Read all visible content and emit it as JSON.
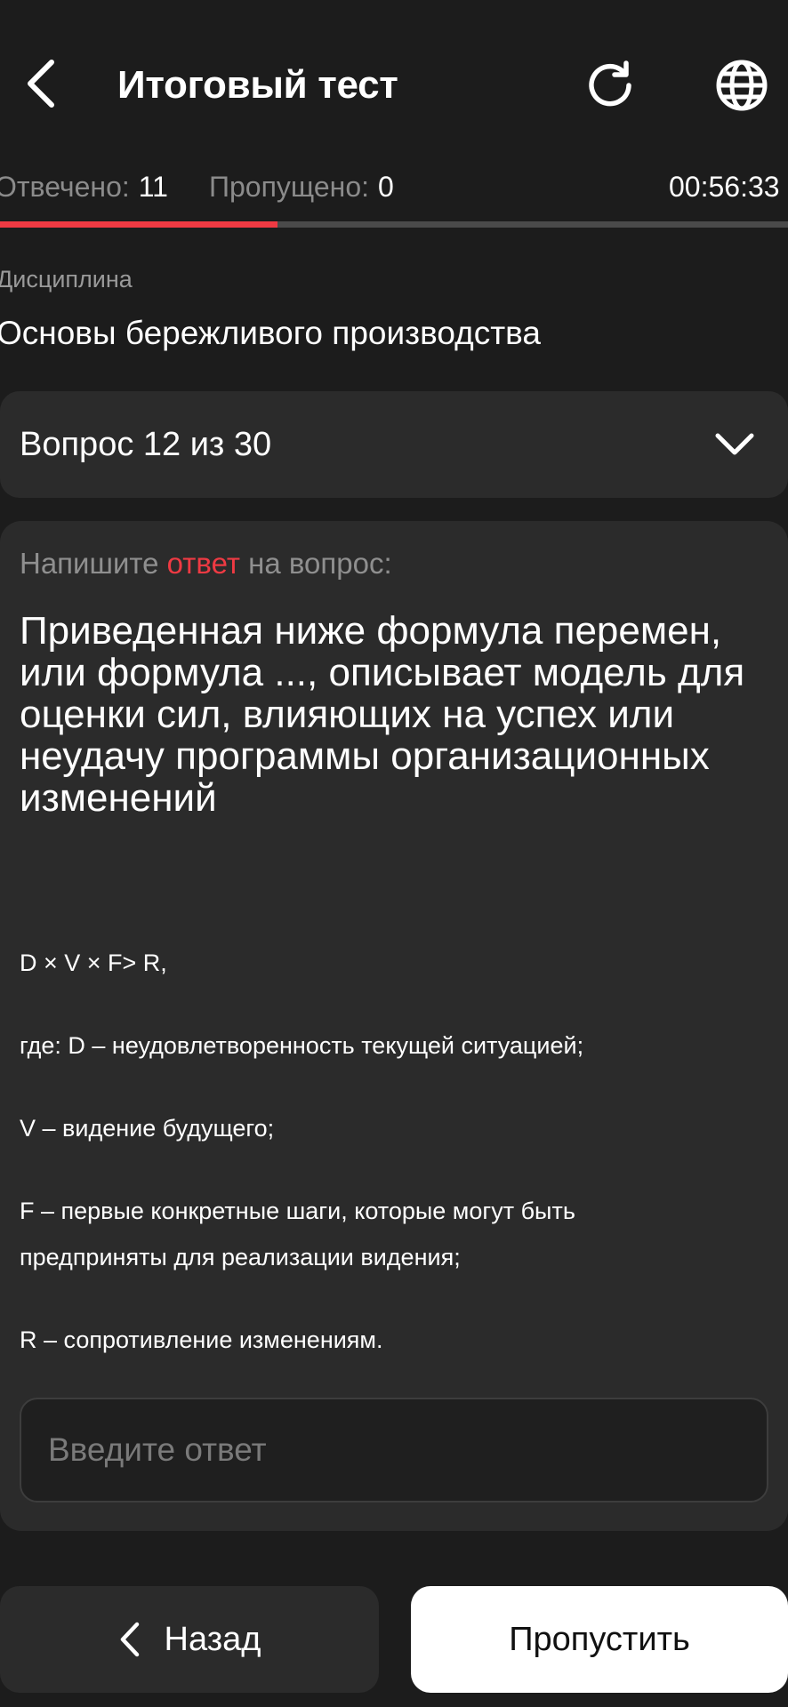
{
  "header": {
    "title": "Итоговый тест",
    "back_icon": "chevron-left-icon",
    "refresh_icon": "refresh-icon",
    "language_icon": "globe-icon"
  },
  "stats": {
    "answered_label": "Отвечено:",
    "answered_value": "11",
    "skipped_label": "Пропущено:",
    "skipped_value": "0",
    "timer": "00:56:33",
    "progress_fraction": 0.352,
    "progress_color": "#ef3a43"
  },
  "discipline": {
    "label": "Дисциплина",
    "value": "Основы бережливого производства"
  },
  "question_selector": {
    "label": "Вопрос 12 из 30",
    "icon": "chevron-down-icon"
  },
  "question": {
    "prompt_before": "Напишите ",
    "prompt_accent": "ответ",
    "prompt_after": " на вопрос:",
    "title": "Приведенная ниже формула перемен, или формула ..., описывает модель для оценки сил, влияющих на успех или неудачу программы организационных изменений",
    "body": [
      "D × V × F> R,",
      "где: D – неудовлетворенность текущей ситуацией;",
      "V – видение будущего;",
      "F – первые конкретные шаги, которые могут быть",
      "предприняты для реализации видения;",
      "R – сопротивление изменениям."
    ]
  },
  "answer_input": {
    "placeholder": "Введите ответ",
    "value": ""
  },
  "footer": {
    "back_label": "Назад",
    "skip_label": "Пропустить"
  },
  "colors": {
    "background": "#1c1c1c",
    "card": "#2b2b2b",
    "accent": "#ef3a43"
  }
}
